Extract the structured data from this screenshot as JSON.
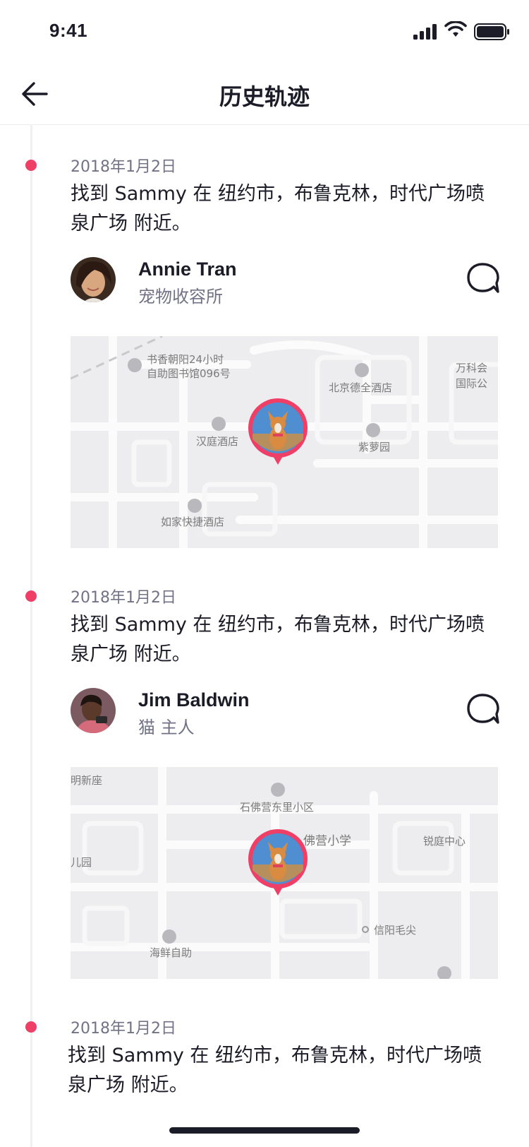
{
  "status_bar": {
    "time": "9:41"
  },
  "header": {
    "title": "历史轨迹"
  },
  "colors": {
    "accent": "#ef3f67",
    "text": "#1c1c28",
    "muted": "#727287"
  },
  "entries": [
    {
      "date": "2018年1月2日",
      "message": "找到 Sammy 在 纽约市，布鲁克林，时代广场喷泉广场 附近。",
      "person": {
        "name": "Annie Tran",
        "role": "宠物收容所"
      },
      "map_labels": [
        "书香朝阳24小时",
        "自助图书馆096号",
        "北京德全酒店",
        "汉庭酒店",
        "紫萝园",
        "如家快捷酒店",
        "万科会",
        "国际公"
      ]
    },
    {
      "date": "2018年1月2日",
      "message": "找到 Sammy 在 纽约市，布鲁克林，时代广场喷泉广场 附近。",
      "person": {
        "name": "Jim Baldwin",
        "role": "猫 主人"
      },
      "map_labels": [
        "明新座",
        "石佛营东里小区",
        "佛营小学",
        "锐庭中心",
        "儿园",
        "信阳毛尖",
        "海鲜自助"
      ]
    },
    {
      "date": "2018年1月2日",
      "message": "找到 Sammy 在 纽约市，布鲁克林，时代广场喷泉广场 附近。"
    }
  ]
}
